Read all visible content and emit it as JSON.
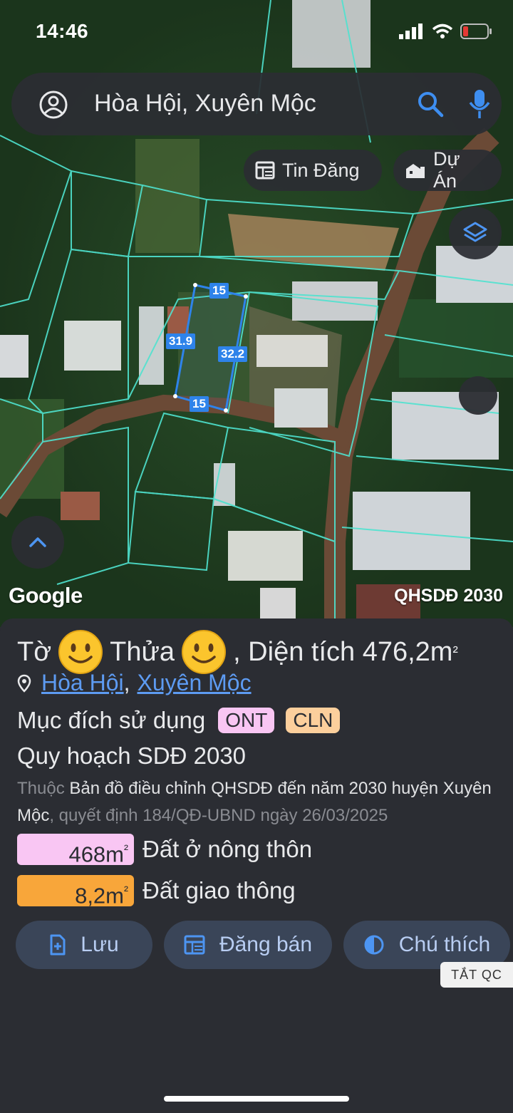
{
  "status_bar": {
    "time": "14:46"
  },
  "search": {
    "text": "Hòa Hội, Xuyên Mộc"
  },
  "chips": {
    "listings": "Tin Đăng",
    "projects": "Dự Án"
  },
  "map": {
    "attribution": "Google",
    "plan_layer": "QHSDĐ 2030",
    "dimensions": {
      "top": "15",
      "left": "31.9",
      "right": "32.2",
      "bottom": "15"
    }
  },
  "parcel": {
    "sheet_label": "Tờ",
    "plot_label": "Thửa",
    "area_text": ", Diện tích 476,2m",
    "area_sup": "²",
    "location": {
      "commune": "Hòa Hội",
      "district": "Xuyên Mộc",
      "separator": ","
    },
    "purpose_label": "Mục đích sử dụng",
    "purpose_codes": [
      "ONT",
      "CLN"
    ],
    "plan_title": "Quy hoạch SDĐ 2030",
    "plan_desc": {
      "prefix": "Thuộc",
      "map_name": "Bản đồ điều chỉnh QHSDĐ đến năm 2030 huyện Xuyên Mộc",
      "suffix": ", quyết định 184/QĐ-UBND ngày 26/03/2025"
    },
    "breakdown": [
      {
        "value": "468m",
        "sup": "²",
        "label": "Đất ở nông thôn",
        "color": "#f9c6f3"
      },
      {
        "value": "8,2m",
        "sup": "²",
        "label": "Đất giao thông",
        "color": "#f8a63a"
      }
    ]
  },
  "actions": {
    "save": "Lưu",
    "post": "Đăng bán",
    "legend": "Chú thích"
  },
  "ad_toggle": "TẮT QC",
  "colors": {
    "accent_blue": "#2e83ea",
    "link": "#5d9bf2",
    "panel_bg": "#2b2d33",
    "action_bg": "#3a4558",
    "parcel_lines": "#4fe3d0"
  }
}
